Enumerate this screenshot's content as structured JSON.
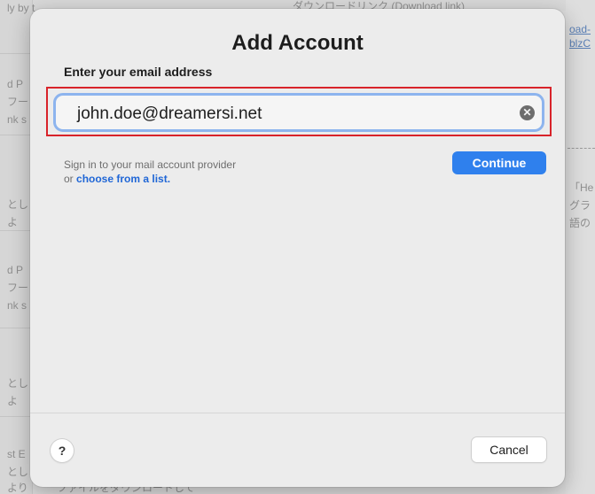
{
  "background": {
    "top_text": "ly by t",
    "top_center_text": "ダウンロードリンク (Download link)",
    "top_right_link": "oad-",
    "top_right_link2": "blzC",
    "left_snippets": [
      "d P",
      "フー",
      "nk s",
      "とし",
      "よ",
      "d P",
      "フー",
      "nk s",
      "とし",
      "よ",
      "st E",
      "とし",
      "より",
      "ファイルをダウンロードして"
    ],
    "right_snippets": [
      "「He",
      "グラ",
      "語の"
    ]
  },
  "dialog": {
    "title": "Add Account",
    "field_label": "Enter your email address",
    "email_value": "john.doe@dreamersi.net",
    "clear_glyph": "✕",
    "hint_line1": "Sign in to your mail account provider",
    "hint_prefix": "or ",
    "hint_link": "choose from a list.",
    "continue_label": "Continue",
    "help_label": "?",
    "cancel_label": "Cancel"
  },
  "colors": {
    "accent": "#2f80ed",
    "focus_ring": "#8db4ee",
    "highlight_box": "#d8232a",
    "link": "#1f66d6"
  }
}
